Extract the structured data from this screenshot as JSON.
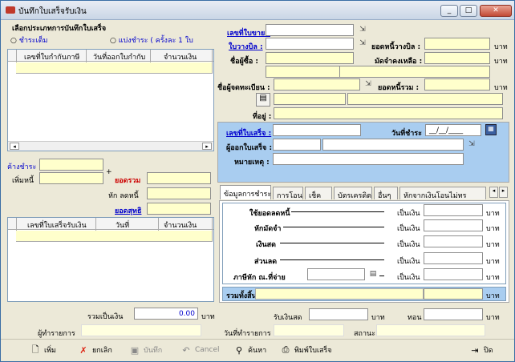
{
  "window": {
    "title": "บันทึกใบเสร็จรับเงิน",
    "min": "_",
    "max": "□",
    "close": "✕"
  },
  "left": {
    "type_title": "เลือกประเภทการบันทึกใบเสร็จ",
    "radio1": "ชำระเต็ม",
    "radio2": "แบ่งชำระ ( ครั้งละ 1 ใบ",
    "grid1_headers": [
      "เลขที่ใบกำกับภาษี",
      "วันที่ออกใบกำกับ",
      "จำนวนเงิน"
    ],
    "deposit": "ค้างชำระ",
    "add": "เพิ่มหนี้",
    "plus": "+",
    "total": "ยอดรวม",
    "deduct": "หัก ลดหนี้",
    "net": "ยอดสุทธิ",
    "grid2_headers": [
      "เลขที่ใบเสร็จรับเงิน",
      "วันที่",
      "จำนวนเงิน"
    ],
    "sum_label": "รวมเป็นเงิน",
    "sum_value": "0.00",
    "baht": "บาท"
  },
  "right": {
    "sale_no": "เลขที่ใบขาย :",
    "bill_no": "ใบวางบิล :",
    "buyer": "ชื่อผู้ซื้อ :",
    "bill_amount": "ยอดหนี้วางบิล :",
    "deposit_left": "มัดจำคงเหลือ :",
    "registrant": "ชื่อผู้จดทะเบียน :",
    "total_debt": "ยอดหนี้รวม :",
    "address": "ที่อยู่ :",
    "receipt_no": "เลขที่ใบเสร็จ :",
    "pay_date": "วันที่ชำระ",
    "date_value": "__/__/____",
    "issuer": "ผู้ออกใบเสร็จ :",
    "note": "หมายเหตุ :",
    "baht": "บาท",
    "tabs": [
      "ข้อมูลการชำระ",
      "การโอน",
      "เช็ค",
      "บัตรเครดิต",
      "อื่นๆ",
      "หักจากเงินโอนไม่ทร"
    ],
    "rows": [
      "ใช้ยอดลดหนี้",
      "หักมัดจำ",
      "เงินสด",
      "ส่วนลด",
      "ภาษีหัก ณ.ที่จ่าย"
    ],
    "as_money": "เป็นเงิน",
    "grand_total": "รวมทั้งสิ้น",
    "cash_received": "รับเงินสด",
    "change": "ทอน"
  },
  "footer": {
    "creator": "ผู้ทำรายการ",
    "created_date": "วันที่ทำรายการ",
    "status": "สถานะ"
  },
  "toolbar": {
    "add": "เพิ่ม",
    "cancel": "ยกเลิก",
    "save": "บันทึก",
    "cancel_en": "Cancel",
    "search": "ค้นหา",
    "print": "พิมพ์ใบเสร็จ",
    "close": "ปิด"
  }
}
